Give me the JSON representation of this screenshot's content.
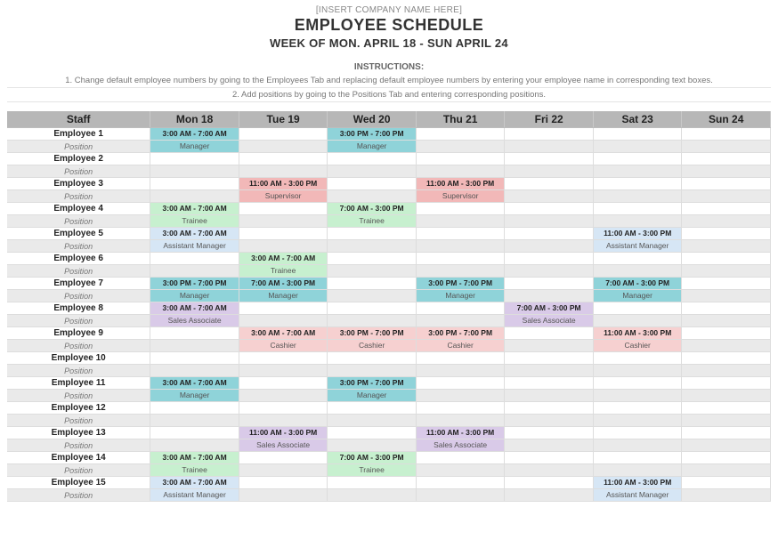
{
  "header": {
    "company_placeholder": "[INSERT COMPANY NAME HERE]",
    "title": "EMPLOYEE SCHEDULE",
    "week": "WEEK OF MON. APRIL 18 - SUN APRIL 24",
    "instructions_label": "INSTRUCTIONS:",
    "instruction_1": "1. Change default employee numbers by going to the Employees Tab and replacing default employee numbers by entering your employee name in corresponding text boxes.",
    "instruction_2": "2. Add positions by going to the Positions Tab and entering corresponding positions."
  },
  "columns": {
    "staff": "Staff",
    "position_label": "Position",
    "days": [
      "Mon 18",
      "Tue 19",
      "Wed 20",
      "Thu 21",
      "Fri 22",
      "Sat 23",
      "Sun 24"
    ]
  },
  "position_colors": {
    "Manager": "c-manager",
    "Supervisor": "c-super",
    "Trainee": "c-trainee",
    "Assistant Manager": "c-assist",
    "Sales Associate": "c-sales",
    "Cashier": "c-cashier"
  },
  "rows": [
    {
      "name": "Employee 1",
      "shifts": [
        {
          "time": "3:00 AM - 7:00 AM",
          "pos": "Manager"
        },
        null,
        {
          "time": "3:00 PM - 7:00 PM",
          "pos": "Manager"
        },
        null,
        null,
        null,
        null
      ]
    },
    {
      "name": "Employee 2",
      "shifts": [
        null,
        null,
        null,
        null,
        null,
        null,
        null
      ]
    },
    {
      "name": "Employee 3",
      "shifts": [
        null,
        {
          "time": "11:00 AM - 3:00 PM",
          "pos": "Supervisor"
        },
        null,
        {
          "time": "11:00 AM - 3:00 PM",
          "pos": "Supervisor"
        },
        null,
        null,
        null
      ]
    },
    {
      "name": "Employee 4",
      "shifts": [
        {
          "time": "3:00 AM - 7:00 AM",
          "pos": "Trainee"
        },
        null,
        {
          "time": "7:00 AM - 3:00 PM",
          "pos": "Trainee"
        },
        null,
        null,
        null,
        null
      ]
    },
    {
      "name": "Employee 5",
      "shifts": [
        {
          "time": "3:00 AM - 7:00 AM",
          "pos": "Assistant Manager"
        },
        null,
        null,
        null,
        null,
        {
          "time": "11:00 AM - 3:00 PM",
          "pos": "Assistant Manager"
        },
        null
      ]
    },
    {
      "name": "Employee 6",
      "shifts": [
        null,
        {
          "time": "3:00 AM - 7:00 AM",
          "pos": "Trainee"
        },
        null,
        null,
        null,
        null,
        null
      ]
    },
    {
      "name": "Employee 7",
      "shifts": [
        {
          "time": "3:00 PM - 7:00 PM",
          "pos": "Manager"
        },
        {
          "time": "7:00 AM - 3:00 PM",
          "pos": "Manager"
        },
        null,
        {
          "time": "3:00 PM - 7:00 PM",
          "pos": "Manager"
        },
        null,
        {
          "time": "7:00 AM - 3:00 PM",
          "pos": "Manager"
        },
        null
      ]
    },
    {
      "name": "Employee 8",
      "shifts": [
        {
          "time": "3:00 AM - 7:00 AM",
          "pos": "Sales Associate"
        },
        null,
        null,
        null,
        {
          "time": "7:00 AM - 3:00 PM",
          "pos": "Sales Associate"
        },
        null,
        null
      ]
    },
    {
      "name": "Employee 9",
      "shifts": [
        null,
        {
          "time": "3:00 AM - 7:00 AM",
          "pos": "Cashier"
        },
        {
          "time": "3:00 PM - 7:00 PM",
          "pos": "Cashier"
        },
        {
          "time": "3:00 PM - 7:00 PM",
          "pos": "Cashier"
        },
        null,
        {
          "time": "11:00 AM - 3:00 PM",
          "pos": "Cashier"
        },
        null
      ]
    },
    {
      "name": "Employee 10",
      "shifts": [
        null,
        null,
        null,
        null,
        null,
        null,
        null
      ]
    },
    {
      "name": "Employee 11",
      "shifts": [
        {
          "time": "3:00 AM - 7:00 AM",
          "pos": "Manager"
        },
        null,
        {
          "time": "3:00 PM - 7:00 PM",
          "pos": "Manager"
        },
        null,
        null,
        null,
        null
      ]
    },
    {
      "name": "Employee 12",
      "shifts": [
        null,
        null,
        null,
        null,
        null,
        null,
        null
      ]
    },
    {
      "name": "Employee 13",
      "shifts": [
        null,
        {
          "time": "11:00 AM - 3:00 PM",
          "pos": "Sales Associate"
        },
        null,
        {
          "time": "11:00 AM - 3:00 PM",
          "pos": "Sales Associate"
        },
        null,
        null,
        null
      ]
    },
    {
      "name": "Employee 14",
      "shifts": [
        {
          "time": "3:00 AM - 7:00 AM",
          "pos": "Trainee"
        },
        null,
        {
          "time": "7:00 AM - 3:00 PM",
          "pos": "Trainee"
        },
        null,
        null,
        null,
        null
      ]
    },
    {
      "name": "Employee 15",
      "shifts": [
        {
          "time": "3:00 AM - 7:00 AM",
          "pos": "Assistant Manager"
        },
        null,
        null,
        null,
        null,
        {
          "time": "11:00 AM - 3:00 PM",
          "pos": "Assistant Manager"
        },
        null
      ]
    }
  ]
}
